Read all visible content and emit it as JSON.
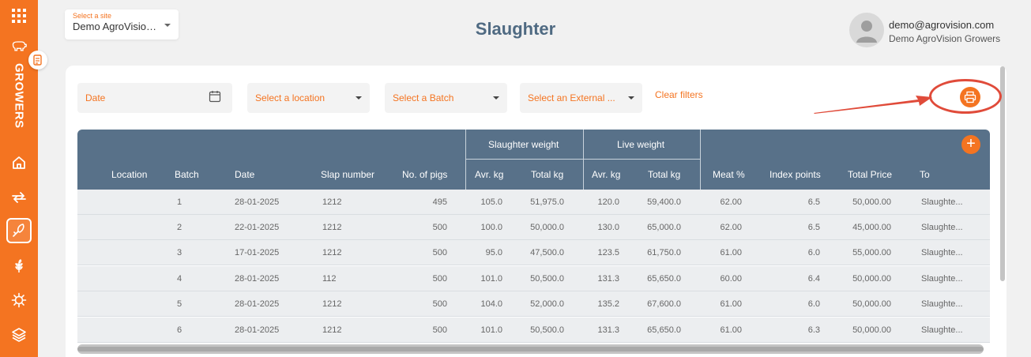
{
  "sidebar": {
    "brand": "GROWERS",
    "icons": [
      "apps-grid-icon",
      "pig-icon",
      "notes-icon",
      "home-icon",
      "transfer-arrows-icon",
      "slaughter-knife-icon",
      "plant-icon",
      "virus-icon",
      "layers-icon"
    ]
  },
  "site": {
    "label": "Select a site",
    "value": "Demo AgroVision ..."
  },
  "page": {
    "title": "Slaughter"
  },
  "user": {
    "email": "demo@agrovision.com",
    "org": "Demo AgroVision Growers"
  },
  "filters": {
    "date": "Date",
    "location": "Select a location",
    "batch": "Select a Batch",
    "external": "Select an External ...",
    "clear": "Clear filters"
  },
  "table": {
    "groups": {
      "slaughter_weight": "Slaughter weight",
      "live_weight": "Live weight"
    },
    "columns": [
      "Location",
      "Batch",
      "Date",
      "Slap number",
      "No. of pigs",
      "Avr. kg",
      "Total kg",
      "Avr. kg",
      "Total kg",
      "Meat %",
      "Index points",
      "Total Price",
      "To"
    ],
    "rows": [
      [
        "",
        "1",
        "28-01-2025",
        "1212",
        "495",
        "105.0",
        "51,975.0",
        "120.0",
        "59,400.0",
        "62.00",
        "6.5",
        "50,000.00",
        "Slaughte..."
      ],
      [
        "",
        "2",
        "22-01-2025",
        "1212",
        "500",
        "100.0",
        "50,000.0",
        "130.0",
        "65,000.0",
        "62.00",
        "6.5",
        "45,000.00",
        "Slaughte..."
      ],
      [
        "",
        "3",
        "17-01-2025",
        "1212",
        "500",
        "95.0",
        "47,500.0",
        "123.5",
        "61,750.0",
        "61.00",
        "6.0",
        "55,000.00",
        "Slaughte..."
      ],
      [
        "",
        "4",
        "28-01-2025",
        "112",
        "500",
        "101.0",
        "50,500.0",
        "131.3",
        "65,650.0",
        "60.00",
        "6.4",
        "50,000.00",
        "Slaughte..."
      ],
      [
        "",
        "5",
        "28-01-2025",
        "1212",
        "500",
        "104.0",
        "52,000.0",
        "135.2",
        "67,600.0",
        "61.00",
        "6.0",
        "50,000.00",
        "Slaughte..."
      ],
      [
        "",
        "6",
        "28-01-2025",
        "1212",
        "500",
        "101.0",
        "50,500.0",
        "131.3",
        "65,650.0",
        "61.00",
        "6.3",
        "50,000.00",
        "Slaughte..."
      ]
    ]
  },
  "colors": {
    "accent": "#f47421",
    "header": "#587189",
    "title": "#4f6a82",
    "annotation": "#e04b3a"
  }
}
